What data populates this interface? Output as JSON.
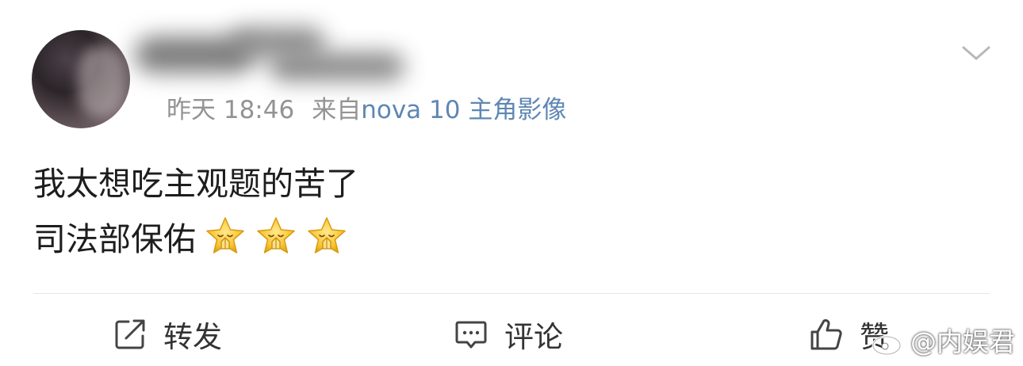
{
  "post": {
    "meta": {
      "time": "昨天 18:46",
      "from_label": "来自",
      "source": "nova 10 主角影像"
    },
    "lines": [
      "我太想吃主观题的苦了",
      "司法部保佑"
    ],
    "emojis": [
      "pray-star-emoji",
      "pray-star-emoji",
      "pray-star-emoji"
    ]
  },
  "actions": {
    "repost": {
      "label": "转发",
      "icon": "share-icon"
    },
    "comment": {
      "label": "评论",
      "icon": "comment-icon"
    },
    "like": {
      "label": "赞",
      "icon": "thumbs-up-icon"
    }
  },
  "watermark": {
    "text": "@内娱君",
    "icon": "weibo-logo"
  },
  "colors": {
    "meta_gray": "#939393",
    "source_link": "#5e87b3",
    "text": "#1d1d1d",
    "divider": "#e6e6e6"
  }
}
